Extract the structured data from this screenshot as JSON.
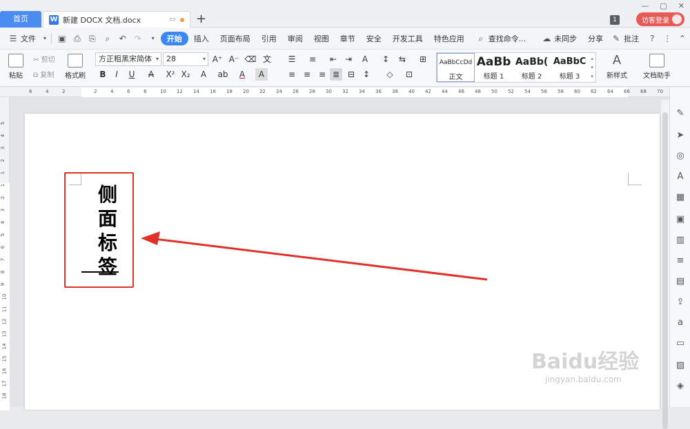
{
  "titlebar": {
    "home_tab": "首页",
    "doc_tab": "新建 DOCX 文档.docx",
    "new_tab_symbol": "+",
    "badge": "1",
    "login": "访客登录",
    "window_controls": [
      "—",
      "▢",
      "✕"
    ]
  },
  "menubar": {
    "file": "文件",
    "items": [
      "开始",
      "插入",
      "页面布局",
      "引用",
      "审阅",
      "视图",
      "章节",
      "安全",
      "开发工具",
      "特色应用"
    ],
    "active_item": "开始",
    "search": "查找命令...",
    "sync": "未同步",
    "share": "分享",
    "comment": "批注"
  },
  "ribbon": {
    "paste": "粘贴",
    "cut": "剪切",
    "copy": "复制",
    "format_painter": "格式刷",
    "font_name": "方正粗黑宋简体",
    "font_size": "28",
    "styles": [
      {
        "preview": "AaBbCcDd",
        "name": "正文"
      },
      {
        "preview": "AaBb",
        "name": "标题 1"
      },
      {
        "preview": "AaBb(",
        "name": "标题 2"
      },
      {
        "preview": "AaBbC",
        "name": "标题 3"
      }
    ],
    "new_style": "新样式",
    "doc_helper": "文档助手"
  },
  "ruler": {
    "h_ticks": [
      "6",
      "4",
      "2",
      "2",
      "4",
      "6",
      "8",
      "10",
      "12",
      "14",
      "16",
      "18",
      "20",
      "22",
      "24",
      "26",
      "28",
      "30",
      "32",
      "34",
      "36",
      "38",
      "40",
      "42",
      "44",
      "46",
      "48",
      "50",
      "52",
      "54",
      "56",
      "58",
      "60",
      "62",
      "64",
      "66",
      "68",
      "70"
    ],
    "v_ticks": [
      "5",
      "4",
      "3",
      "2",
      "1",
      "1",
      "2",
      "3",
      "4",
      "5",
      "6",
      "7",
      "8",
      "9",
      "10",
      "11",
      "12",
      "13",
      "14",
      "15",
      "16",
      "17",
      "18"
    ]
  },
  "document": {
    "vertical_label": [
      "侧",
      "面",
      "标",
      "签"
    ]
  },
  "annotation": {
    "box_color": "#e0302a",
    "arrow_color": "#e0302a"
  },
  "watermark": {
    "line1": "Baidu经验",
    "line2": "jingyan.baidu.com"
  }
}
